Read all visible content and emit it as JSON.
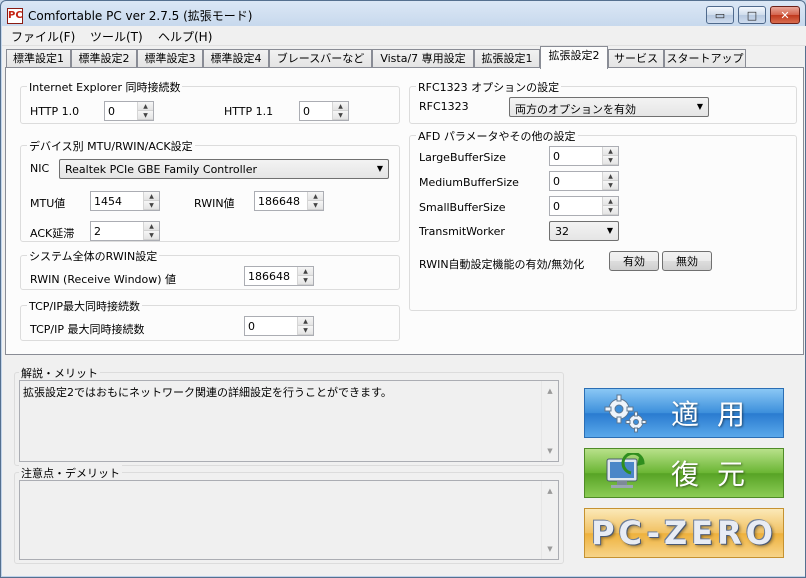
{
  "window": {
    "title": "Comfortable PC ver 2.7.5 (拡張モード)",
    "app_icon_glyph": "PC",
    "controls": {
      "minimize": "▭",
      "maximize": "□",
      "close": "✕"
    }
  },
  "menu": [
    "ファイル(F)",
    "ツール(T)",
    "ヘルプ(H)"
  ],
  "tabs": [
    {
      "label": "標準設定1",
      "active": false
    },
    {
      "label": "標準設定2",
      "active": false
    },
    {
      "label": "標準設定3",
      "active": false
    },
    {
      "label": "標準設定4",
      "active": false
    },
    {
      "label": "ブレースバーなど",
      "active": false
    },
    {
      "label": "Vista/7 専用設定",
      "active": false
    },
    {
      "label": "拡張設定1",
      "active": false
    },
    {
      "label": "拡張設定2",
      "active": true
    },
    {
      "label": "サービス",
      "active": false
    },
    {
      "label": "スタートアップ",
      "active": false
    }
  ],
  "ie_group": {
    "title": "Internet Explorer 同時接続数",
    "http10_label": "HTTP 1.0",
    "http10_value": "0",
    "http11_label": "HTTP 1.1",
    "http11_value": "0"
  },
  "mtu_group": {
    "title": "デバイス別 MTU/RWIN/ACK設定",
    "nic_label": "NIC",
    "nic_value": "Realtek PCIe GBE Family Controller",
    "mtu_label": "MTU値",
    "mtu_value": "1454",
    "rwin_label": "RWIN値",
    "rwin_value": "186648",
    "ack_label": "ACK延滞",
    "ack_value": "2"
  },
  "rwin_group": {
    "title": "システム全体のRWIN設定",
    "label": "RWIN (Receive Window) 値",
    "value": "186648"
  },
  "tcp_group": {
    "title": "TCP/IP最大同時接続数",
    "label": "TCP/IP 最大同時接続数",
    "value": "0"
  },
  "rfc_group": {
    "title": "RFC1323 オプションの設定",
    "label": "RFC1323",
    "value": "両方のオプションを有効"
  },
  "afd_group": {
    "title": "AFD パラメータやその他の設定",
    "large_label": "LargeBufferSize",
    "large_value": "0",
    "medium_label": "MediumBufferSize",
    "medium_value": "0",
    "small_label": "SmallBufferSize",
    "small_value": "0",
    "worker_label": "TransmitWorker",
    "worker_value": "32",
    "rwin_auto_label": "RWIN自動設定機能の有効/無効化",
    "enable_label": "有効",
    "disable_label": "無効"
  },
  "description": {
    "title": "解説・メリット",
    "text": "拡張設定2ではおもにネットワーク関連の詳細設定を行うことができます。"
  },
  "caution": {
    "title": "注意点・デメリット",
    "text": ""
  },
  "actions": {
    "apply_label": "適用",
    "restore_label": "復元",
    "pc_zero_label": "PC-ZERO"
  },
  "icons": {
    "apply": "gears-icon",
    "restore": "computer-restore-icon"
  }
}
